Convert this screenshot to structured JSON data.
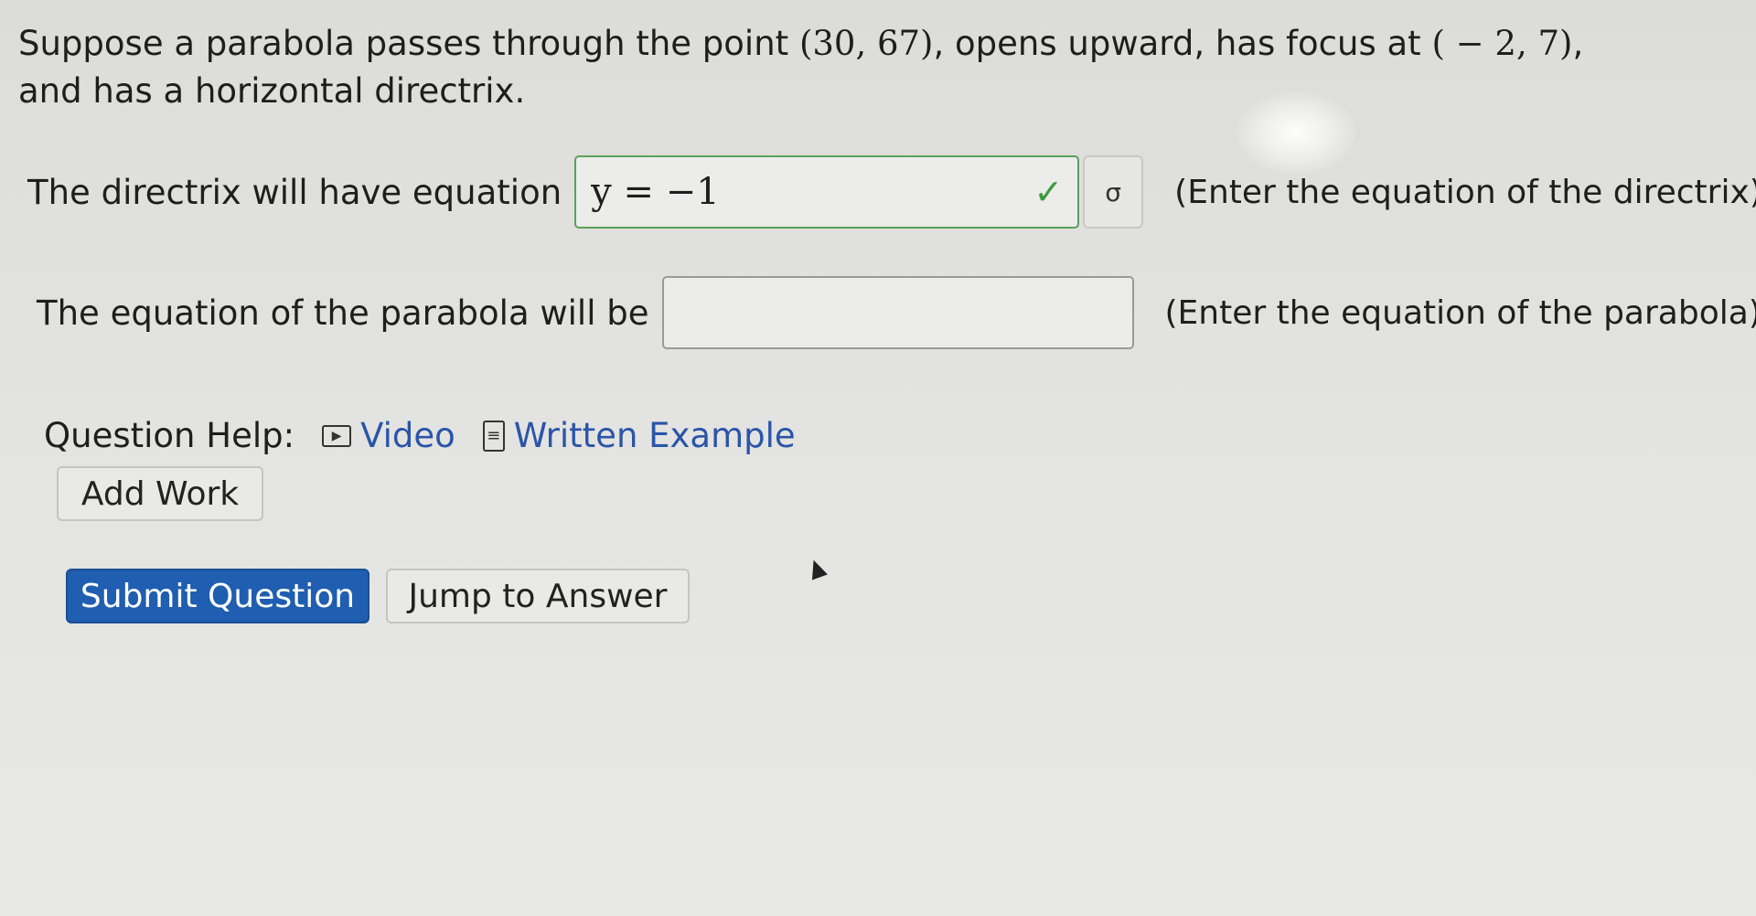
{
  "question": {
    "text_before_point": "Suppose a parabola passes through the point ",
    "point": "(30, 67)",
    "text_middle": ", opens upward, has focus at ",
    "focus": "( − 2, 7)",
    "text_after": ", and has a horizontal directrix."
  },
  "directrix_row": {
    "label": "The directrix will have equation",
    "value": "y = −1",
    "status_icon": "checkmark-icon",
    "equation_button_glyph": "σ",
    "hint": "(Enter the equation of the directrix)"
  },
  "parabola_row": {
    "label": "The equation of the parabola will be",
    "value": "",
    "hint": "(Enter the equation of the parabola)"
  },
  "question_help": {
    "label": "Question Help:",
    "video": "Video",
    "written_example": "Written Example"
  },
  "buttons": {
    "add_work": "Add Work",
    "submit": "Submit Question",
    "jump": "Jump to Answer"
  },
  "colors": {
    "primary": "#1f5eb0",
    "link": "#2a55a8",
    "correct": "#3c9a3c"
  }
}
